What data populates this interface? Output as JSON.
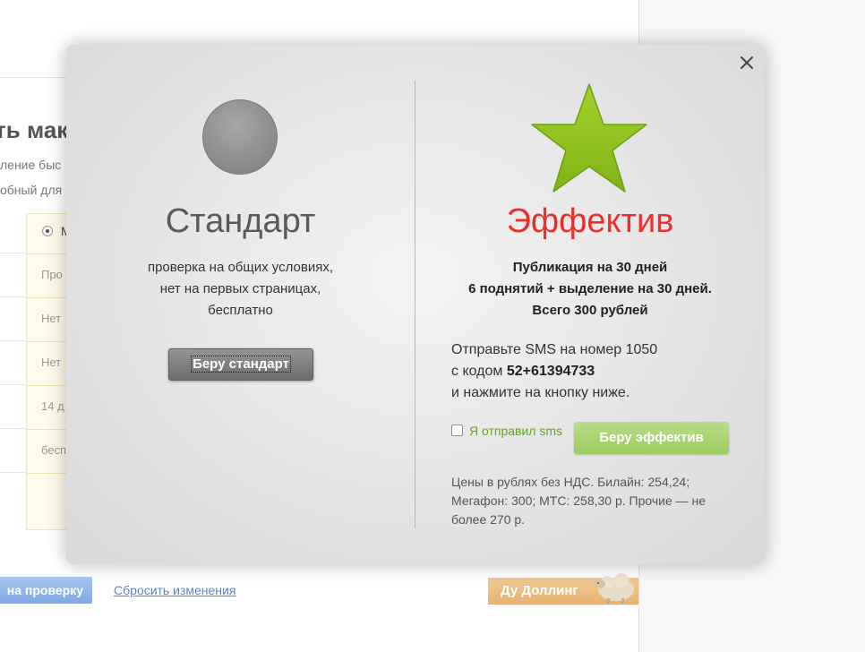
{
  "background": {
    "heading": "ть мак",
    "text_line1": "ление быс",
    "text_line2": "обный для",
    "table": {
      "radio_label": "М",
      "rows": [
        "Про",
        "Нет",
        "Нет",
        "14 д",
        "бесп"
      ]
    },
    "submit_label": "на проверку",
    "reset_label": "Сбросить изменения",
    "badge_label": "Ду Доллинг"
  },
  "modal": {
    "close_icon": "close-icon",
    "standard": {
      "icon": "gray-circle-icon",
      "title": "Стандарт",
      "desc_lines": [
        "проверка на общих условиях,",
        "нет на первых страницах,",
        "бесплатно"
      ],
      "button_label": "Беру стандарт"
    },
    "effective": {
      "icon": "green-star-icon",
      "title": "Эффектив",
      "info_lines": [
        "Публикация на 30 дней",
        "6 поднятий + выделение на 30 дней.",
        "Всего 300 рублей"
      ],
      "sms_line1": "Отправьте SMS на номер 1050",
      "sms_code_prefix": "с кодом",
      "sms_code": "52+61394733",
      "sms_line3": "и нажмите на кнопку ниже.",
      "checkbox_label": "Я отправил sms",
      "checkbox_checked": false,
      "button_label": "Беру эффектив",
      "prices_note": "Цены в рублях без НДС. Билайн: 254,24; Мегафон: 300; МТС: 258,30 р. Прочие — не более 270 р."
    },
    "colors": {
      "effective_title": "#ee2d2d",
      "star": "#8cc21f",
      "checkbox_label": "#63a51a",
      "effective_button": "#a8d46f"
    }
  }
}
